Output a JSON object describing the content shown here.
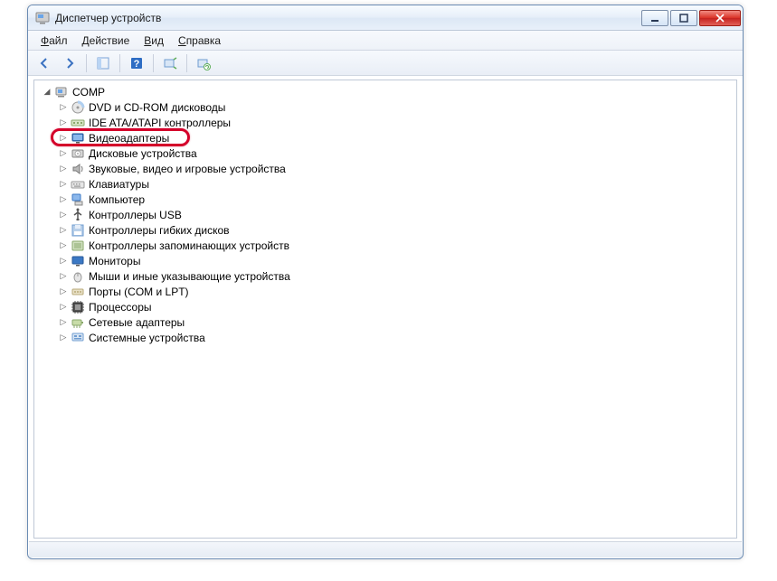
{
  "window": {
    "title": "Диспетчер устройств"
  },
  "menu": {
    "file": "Файл",
    "action": "Действие",
    "view": "Вид",
    "help": "Справка"
  },
  "tree": {
    "root": "COMP",
    "categories": [
      {
        "label": "DVD и CD-ROM дисководы",
        "icon": "optical"
      },
      {
        "label": "IDE ATA/ATAPI контроллеры",
        "icon": "ide"
      },
      {
        "label": "Видеоадаптеры",
        "icon": "display",
        "highlighted": true
      },
      {
        "label": "Дисковые устройства",
        "icon": "disk"
      },
      {
        "label": "Звуковые, видео и игровые устройства",
        "icon": "audio"
      },
      {
        "label": "Клавиатуры",
        "icon": "keyboard"
      },
      {
        "label": "Компьютер",
        "icon": "computer"
      },
      {
        "label": "Контроллеры USB",
        "icon": "usb"
      },
      {
        "label": "Контроллеры гибких дисков",
        "icon": "floppy"
      },
      {
        "label": "Контроллеры запоминающих устройств",
        "icon": "storage"
      },
      {
        "label": "Мониторы",
        "icon": "monitor"
      },
      {
        "label": "Мыши и иные указывающие устройства",
        "icon": "mouse"
      },
      {
        "label": "Порты (COM и LPT)",
        "icon": "port"
      },
      {
        "label": "Процессоры",
        "icon": "cpu"
      },
      {
        "label": "Сетевые адаптеры",
        "icon": "network"
      },
      {
        "label": "Системные устройства",
        "icon": "system"
      }
    ]
  }
}
